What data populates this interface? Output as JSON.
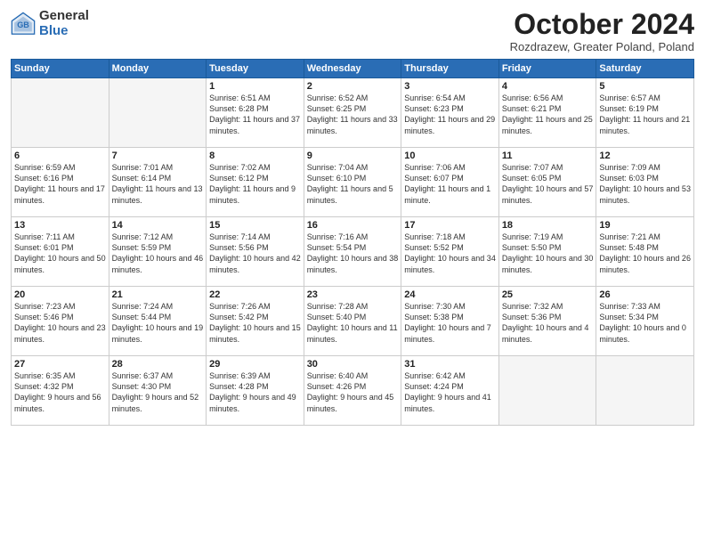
{
  "logo": {
    "general": "General",
    "blue": "Blue"
  },
  "title": "October 2024",
  "location": "Rozdrazew, Greater Poland, Poland",
  "days_of_week": [
    "Sunday",
    "Monday",
    "Tuesday",
    "Wednesday",
    "Thursday",
    "Friday",
    "Saturday"
  ],
  "weeks": [
    [
      {
        "day": "",
        "info": ""
      },
      {
        "day": "",
        "info": ""
      },
      {
        "day": "1",
        "info": "Sunrise: 6:51 AM\nSunset: 6:28 PM\nDaylight: 11 hours and 37 minutes."
      },
      {
        "day": "2",
        "info": "Sunrise: 6:52 AM\nSunset: 6:25 PM\nDaylight: 11 hours and 33 minutes."
      },
      {
        "day": "3",
        "info": "Sunrise: 6:54 AM\nSunset: 6:23 PM\nDaylight: 11 hours and 29 minutes."
      },
      {
        "day": "4",
        "info": "Sunrise: 6:56 AM\nSunset: 6:21 PM\nDaylight: 11 hours and 25 minutes."
      },
      {
        "day": "5",
        "info": "Sunrise: 6:57 AM\nSunset: 6:19 PM\nDaylight: 11 hours and 21 minutes."
      }
    ],
    [
      {
        "day": "6",
        "info": "Sunrise: 6:59 AM\nSunset: 6:16 PM\nDaylight: 11 hours and 17 minutes."
      },
      {
        "day": "7",
        "info": "Sunrise: 7:01 AM\nSunset: 6:14 PM\nDaylight: 11 hours and 13 minutes."
      },
      {
        "day": "8",
        "info": "Sunrise: 7:02 AM\nSunset: 6:12 PM\nDaylight: 11 hours and 9 minutes."
      },
      {
        "day": "9",
        "info": "Sunrise: 7:04 AM\nSunset: 6:10 PM\nDaylight: 11 hours and 5 minutes."
      },
      {
        "day": "10",
        "info": "Sunrise: 7:06 AM\nSunset: 6:07 PM\nDaylight: 11 hours and 1 minute."
      },
      {
        "day": "11",
        "info": "Sunrise: 7:07 AM\nSunset: 6:05 PM\nDaylight: 10 hours and 57 minutes."
      },
      {
        "day": "12",
        "info": "Sunrise: 7:09 AM\nSunset: 6:03 PM\nDaylight: 10 hours and 53 minutes."
      }
    ],
    [
      {
        "day": "13",
        "info": "Sunrise: 7:11 AM\nSunset: 6:01 PM\nDaylight: 10 hours and 50 minutes."
      },
      {
        "day": "14",
        "info": "Sunrise: 7:12 AM\nSunset: 5:59 PM\nDaylight: 10 hours and 46 minutes."
      },
      {
        "day": "15",
        "info": "Sunrise: 7:14 AM\nSunset: 5:56 PM\nDaylight: 10 hours and 42 minutes."
      },
      {
        "day": "16",
        "info": "Sunrise: 7:16 AM\nSunset: 5:54 PM\nDaylight: 10 hours and 38 minutes."
      },
      {
        "day": "17",
        "info": "Sunrise: 7:18 AM\nSunset: 5:52 PM\nDaylight: 10 hours and 34 minutes."
      },
      {
        "day": "18",
        "info": "Sunrise: 7:19 AM\nSunset: 5:50 PM\nDaylight: 10 hours and 30 minutes."
      },
      {
        "day": "19",
        "info": "Sunrise: 7:21 AM\nSunset: 5:48 PM\nDaylight: 10 hours and 26 minutes."
      }
    ],
    [
      {
        "day": "20",
        "info": "Sunrise: 7:23 AM\nSunset: 5:46 PM\nDaylight: 10 hours and 23 minutes."
      },
      {
        "day": "21",
        "info": "Sunrise: 7:24 AM\nSunset: 5:44 PM\nDaylight: 10 hours and 19 minutes."
      },
      {
        "day": "22",
        "info": "Sunrise: 7:26 AM\nSunset: 5:42 PM\nDaylight: 10 hours and 15 minutes."
      },
      {
        "day": "23",
        "info": "Sunrise: 7:28 AM\nSunset: 5:40 PM\nDaylight: 10 hours and 11 minutes."
      },
      {
        "day": "24",
        "info": "Sunrise: 7:30 AM\nSunset: 5:38 PM\nDaylight: 10 hours and 7 minutes."
      },
      {
        "day": "25",
        "info": "Sunrise: 7:32 AM\nSunset: 5:36 PM\nDaylight: 10 hours and 4 minutes."
      },
      {
        "day": "26",
        "info": "Sunrise: 7:33 AM\nSunset: 5:34 PM\nDaylight: 10 hours and 0 minutes."
      }
    ],
    [
      {
        "day": "27",
        "info": "Sunrise: 6:35 AM\nSunset: 4:32 PM\nDaylight: 9 hours and 56 minutes."
      },
      {
        "day": "28",
        "info": "Sunrise: 6:37 AM\nSunset: 4:30 PM\nDaylight: 9 hours and 52 minutes."
      },
      {
        "day": "29",
        "info": "Sunrise: 6:39 AM\nSunset: 4:28 PM\nDaylight: 9 hours and 49 minutes."
      },
      {
        "day": "30",
        "info": "Sunrise: 6:40 AM\nSunset: 4:26 PM\nDaylight: 9 hours and 45 minutes."
      },
      {
        "day": "31",
        "info": "Sunrise: 6:42 AM\nSunset: 4:24 PM\nDaylight: 9 hours and 41 minutes."
      },
      {
        "day": "",
        "info": ""
      },
      {
        "day": "",
        "info": ""
      }
    ]
  ]
}
